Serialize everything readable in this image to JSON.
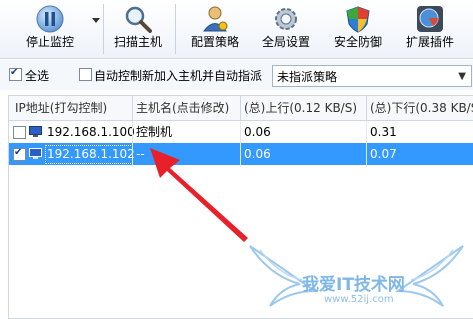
{
  "toolbar": {
    "buttons": [
      {
        "label": "停止监控",
        "icon": "pause-icon"
      },
      {
        "label": "扫描主机",
        "icon": "magnifier-icon"
      },
      {
        "label": "配置策略",
        "icon": "user-settings-icon"
      },
      {
        "label": "全局设置",
        "icon": "gear-icon"
      },
      {
        "label": "安全防御",
        "icon": "shield-icon"
      },
      {
        "label": "扩展插件",
        "icon": "plugin-icon"
      }
    ]
  },
  "options": {
    "select_all_label": "全选",
    "select_all_checked": true,
    "auto_control_label": "自动控制新加入主机并自动指派",
    "auto_control_checked": false,
    "policy_selected": "未指派策略"
  },
  "table": {
    "columns": [
      "IP地址(打勾控制)",
      "主机名(点击修改)",
      "(总)上行(0.12 KB/S)",
      "(总)下行(0.38 KB/S)"
    ],
    "rows": [
      {
        "ip": "192.168.1.100",
        "hostname": "控制机",
        "up": "0.06",
        "down": "0.31",
        "checked": false,
        "selected": false
      },
      {
        "ip": "192.168.1.102",
        "hostname": "--",
        "up": "0.06",
        "down": "0.07",
        "checked": true,
        "selected": true
      }
    ]
  },
  "watermark": {
    "text": "我爱IT技术网",
    "url": "www.52ij.com"
  },
  "colors": {
    "selection": "#3399ff",
    "arrow": "#e8202a",
    "watermark": "#7fb7e6"
  }
}
